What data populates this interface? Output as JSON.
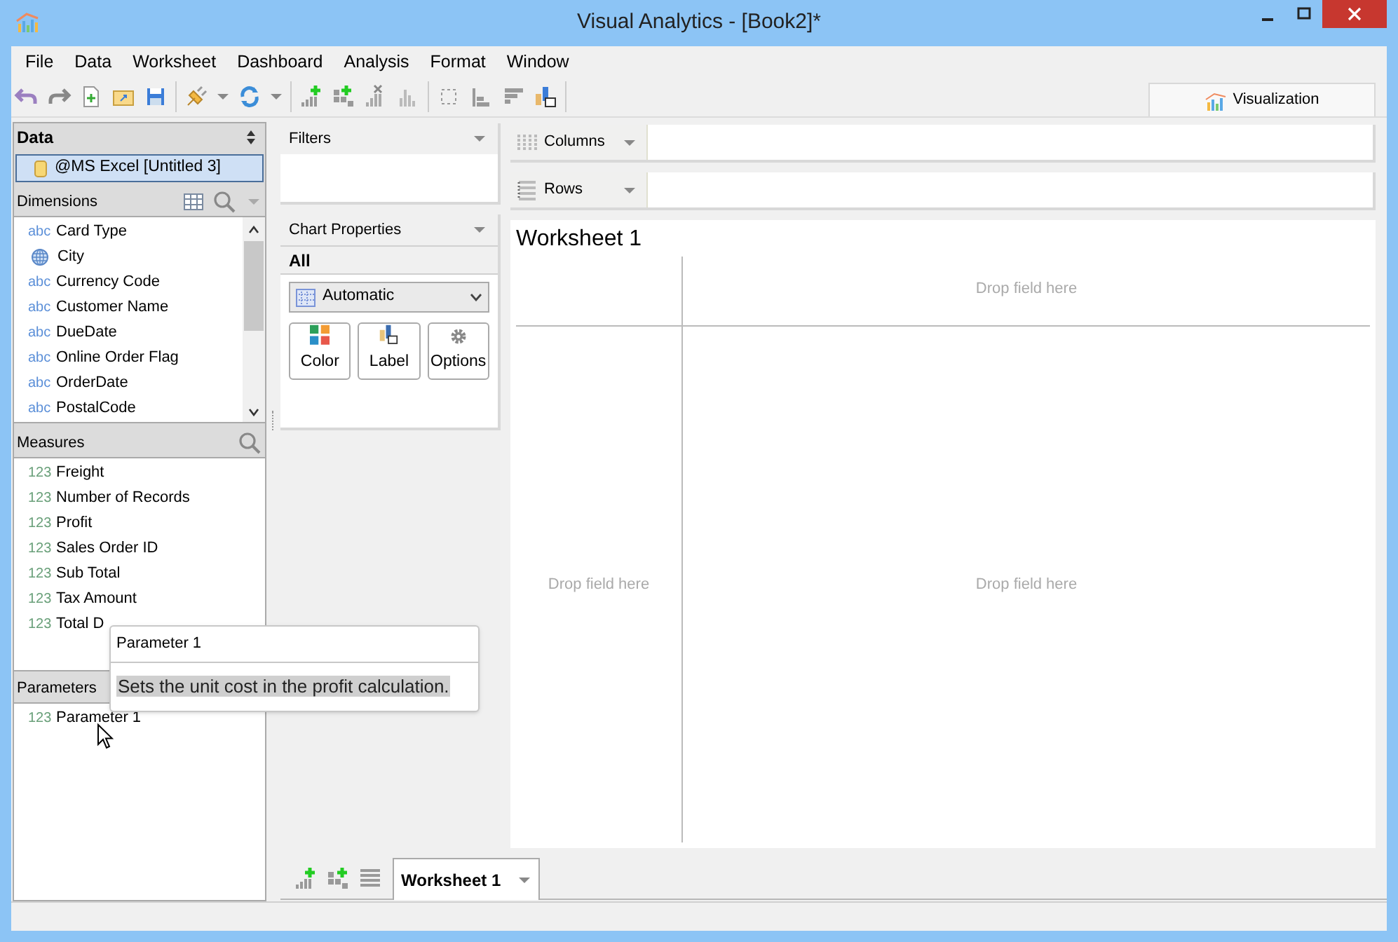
{
  "window": {
    "title": "Visual Analytics - [Book2]*"
  },
  "menu": [
    "File",
    "Data",
    "Worksheet",
    "Dashboard",
    "Analysis",
    "Format",
    "Window"
  ],
  "view_tab": {
    "label": "Visualization",
    "selected": true
  },
  "data_panel": {
    "title": "Data",
    "source": {
      "label": "@MS Excel [Untitled 3]",
      "selected": true
    }
  },
  "dimensions": {
    "title": "Dimensions",
    "items": [
      {
        "kind": "text",
        "badge": "abc",
        "name": "Card Type"
      },
      {
        "kind": "geo",
        "name": "City"
      },
      {
        "kind": "text",
        "badge": "abc",
        "name": "Currency Code"
      },
      {
        "kind": "text",
        "badge": "abc",
        "name": "Customer Name"
      },
      {
        "kind": "text",
        "badge": "abc",
        "name": "DueDate"
      },
      {
        "kind": "text",
        "badge": "abc",
        "name": "Online Order Flag"
      },
      {
        "kind": "text",
        "badge": "abc",
        "name": "OrderDate"
      },
      {
        "kind": "text",
        "badge": "abc",
        "name": "PostalCode"
      }
    ]
  },
  "measures": {
    "title": "Measures",
    "items": [
      {
        "badge": "123",
        "name": "Freight"
      },
      {
        "badge": "123",
        "name": "Number of Records"
      },
      {
        "badge": "123",
        "name": "Profit"
      },
      {
        "badge": "123",
        "name": "Sales Order ID"
      },
      {
        "badge": "123",
        "name": "Sub Total"
      },
      {
        "badge": "123",
        "name": "Tax Amount"
      },
      {
        "badge": "123",
        "name": "Total D"
      }
    ]
  },
  "parameters": {
    "title": "Parameters",
    "items": [
      {
        "badge": "123",
        "name": "Parameter 1"
      }
    ]
  },
  "tooltip": {
    "title": "Parameter 1",
    "text": "Sets the unit cost in the profit calculation."
  },
  "filters": {
    "title": "Filters"
  },
  "chart_properties": {
    "title": "Chart Properties",
    "section": "All",
    "mark_type": "Automatic",
    "buttons": [
      {
        "kind": "color",
        "label": "Color"
      },
      {
        "kind": "label",
        "label": "Label"
      },
      {
        "kind": "options",
        "label": "Options"
      }
    ]
  },
  "shelves": [
    {
      "kind": "columns",
      "label": "Columns"
    },
    {
      "kind": "rows",
      "label": "Rows"
    }
  ],
  "worksheet": {
    "title": "Worksheet 1",
    "drop_top": "Drop field here",
    "drop_left": "Drop field here",
    "drop_main": "Drop field here"
  },
  "sheet_tabs": [
    {
      "label": "Worksheet 1",
      "selected": true
    }
  ]
}
